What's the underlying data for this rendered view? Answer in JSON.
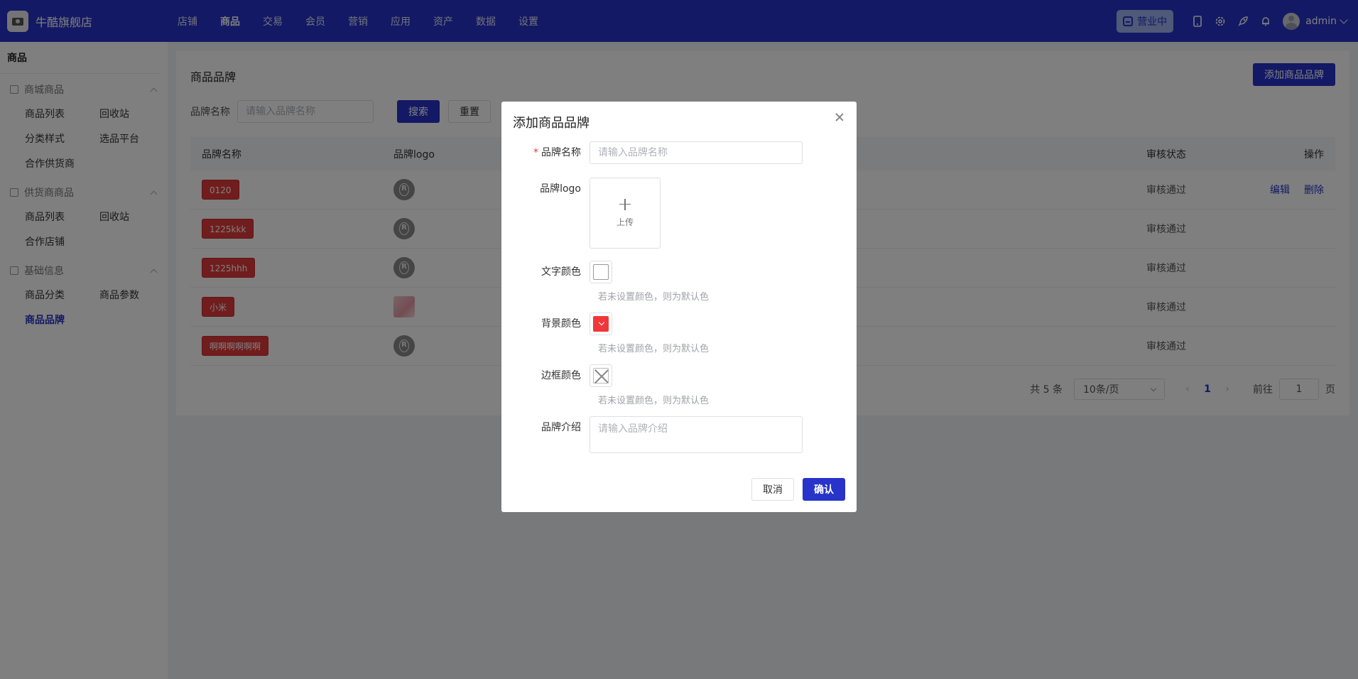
{
  "app": {
    "shop_name": "牛酷旗舰店"
  },
  "top_menu": [
    "店铺",
    "商品",
    "交易",
    "会员",
    "营销",
    "应用",
    "资产",
    "数据",
    "设置"
  ],
  "top_right": {
    "status": "营业中",
    "user": "admin"
  },
  "sidebar": {
    "title": "商品",
    "groups": [
      {
        "label": "商城商品",
        "items": [
          "商品列表",
          "回收站",
          "分类样式",
          "选品平台",
          "合作供货商"
        ]
      },
      {
        "label": "供货商商品",
        "items": [
          "商品列表",
          "回收站",
          "合作店铺"
        ]
      },
      {
        "label": "基础信息",
        "items": [
          "商品分类",
          "商品参数",
          "商品品牌"
        ]
      }
    ],
    "active_item": "商品品牌"
  },
  "main": {
    "title": "商品品牌",
    "add_button": "添加商品品牌",
    "filter": {
      "label": "品牌名称",
      "placeholder": "请输入品牌名称",
      "search": "搜索",
      "reset": "重置"
    },
    "table": {
      "headers": [
        "品牌名称",
        "品牌logo",
        "审核状态",
        "操作"
      ],
      "rows": [
        {
          "name": "0120",
          "logo": "r-icon",
          "status": "审核通过",
          "actions": [
            "编辑",
            "删除"
          ]
        },
        {
          "name": "1225kkk",
          "logo": "r-icon",
          "status": "审核通过",
          "actions": []
        },
        {
          "name": "1225hhh",
          "logo": "r-icon",
          "status": "审核通过",
          "actions": []
        },
        {
          "name": "小米",
          "logo": "image-thumbnail",
          "status": "审核通过",
          "actions": []
        },
        {
          "name": "啊啊啊啊啊啊",
          "logo": "r-icon",
          "status": "审核通过",
          "actions": []
        }
      ]
    },
    "pagination": {
      "total": "共 5 条",
      "page_size": "10条/页",
      "current": "1",
      "goto_label": "前往",
      "goto_value": "1",
      "page_suffix": "页"
    }
  },
  "modal": {
    "title": "添加商品品牌",
    "fields": {
      "name": {
        "label": "品牌名称",
        "placeholder": "请输入品牌名称"
      },
      "logo": {
        "label": "品牌logo",
        "upload": "上传"
      },
      "text_color": {
        "label": "文字颜色",
        "hint": "若未设置颜色，则为默认色"
      },
      "bg_color": {
        "label": "背景颜色",
        "hint": "若未设置颜色，则为默认色",
        "value": "#f0383b"
      },
      "border_color": {
        "label": "边框颜色",
        "hint": "若未设置颜色，则为默认色"
      },
      "intro": {
        "label": "品牌介绍",
        "placeholder": "请输入品牌介绍"
      }
    },
    "cancel": "取消",
    "confirm": "确认"
  }
}
